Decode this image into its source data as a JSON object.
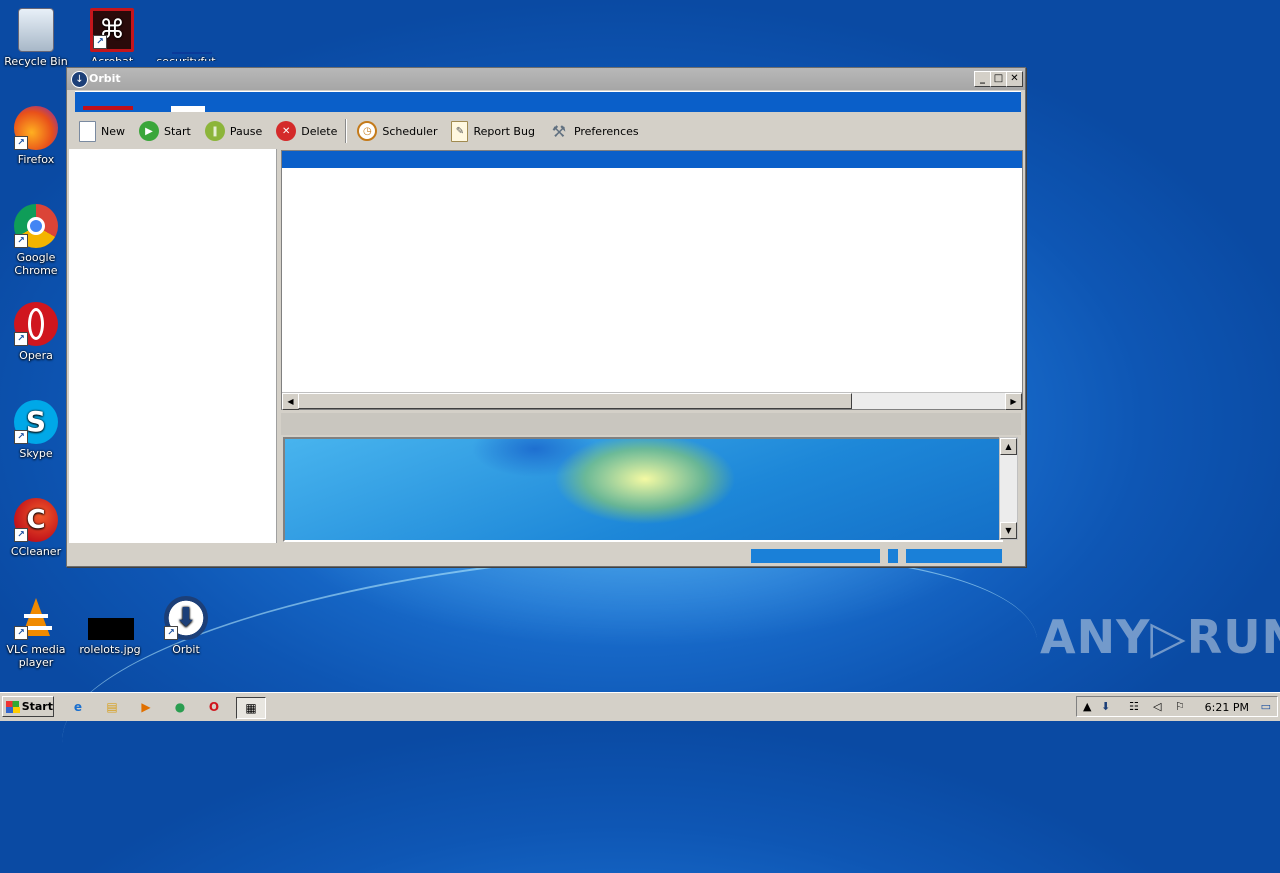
{
  "desktop": {
    "icons": [
      {
        "label": "Recycle Bin"
      },
      {
        "label": "Acrobat"
      },
      {
        "label": "securityfut"
      },
      {
        "label": "Firefox"
      },
      {
        "label": "Google Chrome"
      },
      {
        "label": "Opera"
      },
      {
        "label": "Skype"
      },
      {
        "label": "CCleaner"
      },
      {
        "label": "VLC media player"
      },
      {
        "label": "rolelots.jpg"
      },
      {
        "label": "Orbit"
      }
    ],
    "watermark": "ANY▷RUN"
  },
  "window": {
    "title": "Orbit",
    "controls": {
      "minimize": "_",
      "maximize": "□",
      "close": "✕"
    },
    "toolbar": {
      "new": "New",
      "start": "Start",
      "pause": "Pause",
      "delete": "Delete",
      "scheduler": "Scheduler",
      "report_bug": "Report Bug",
      "preferences": "Preferences"
    }
  },
  "taskbar": {
    "start_label": "Start",
    "clock": "6:21 PM"
  },
  "colors": {
    "accent": "#0a5fc9",
    "start_icon": "#3aa63a",
    "pause_icon": "#8cb53a",
    "delete_icon": "#d42a2a"
  }
}
